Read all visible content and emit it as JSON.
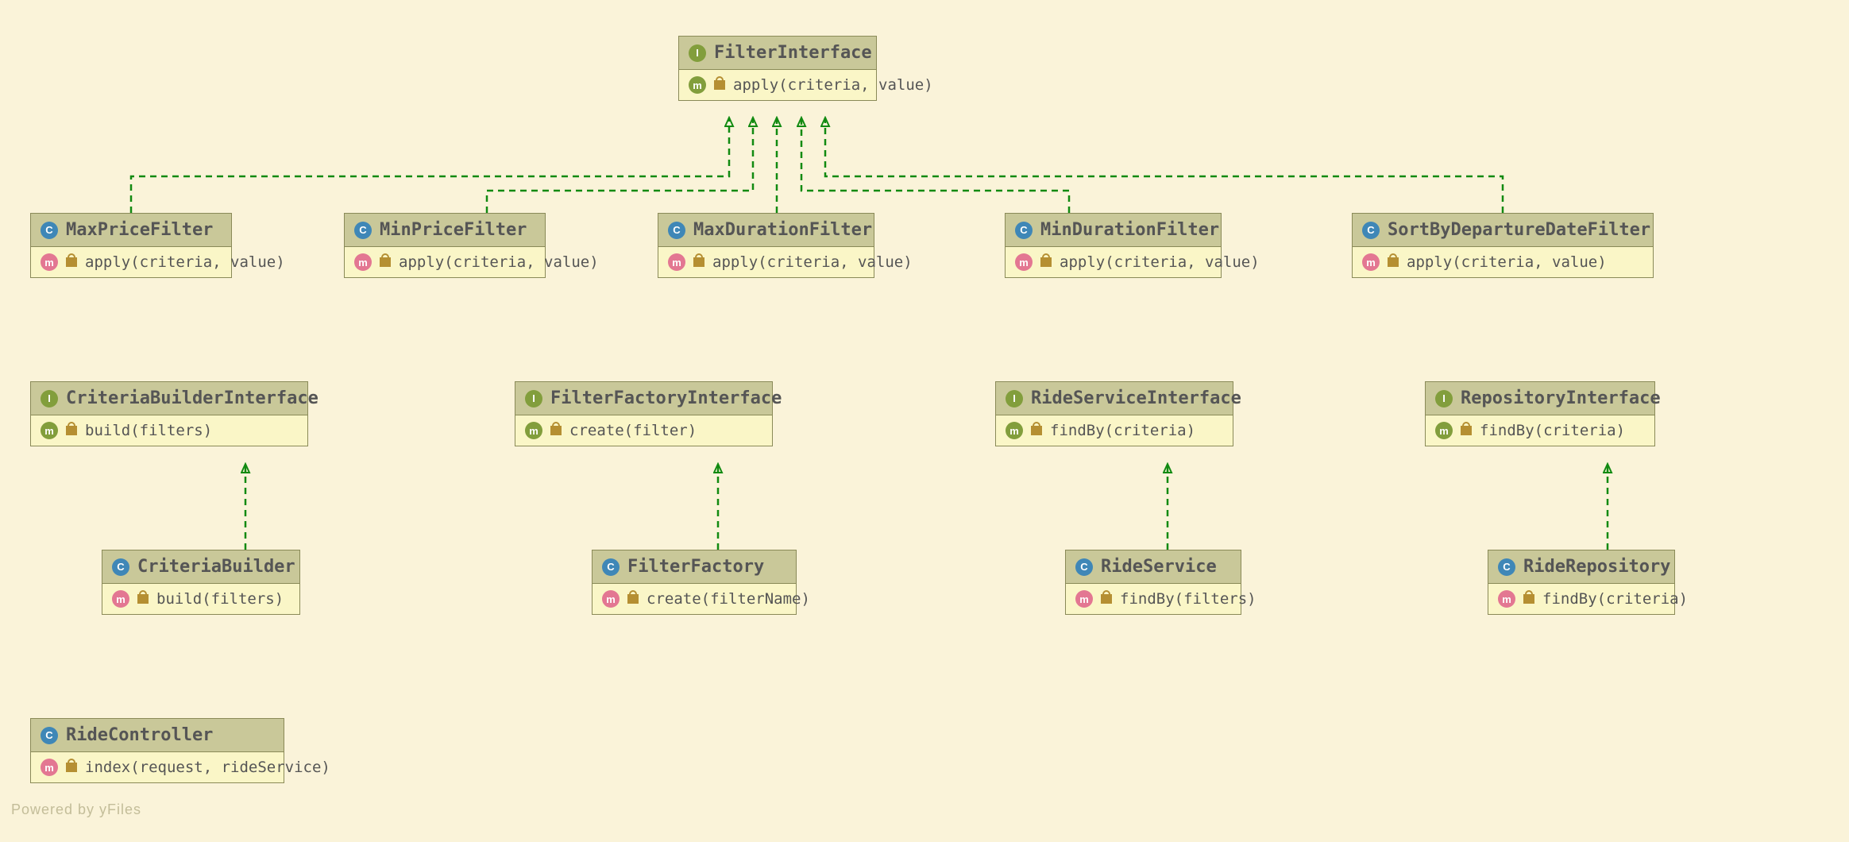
{
  "chart_data": {
    "type": "uml-class-diagram",
    "nodes": [
      {
        "id": "FilterInterface",
        "kind": "interface",
        "methods": [
          "apply(criteria, value)"
        ]
      },
      {
        "id": "MaxPriceFilter",
        "kind": "class",
        "methods": [
          "apply(criteria, value)"
        ]
      },
      {
        "id": "MinPriceFilter",
        "kind": "class",
        "methods": [
          "apply(criteria, value)"
        ]
      },
      {
        "id": "MaxDurationFilter",
        "kind": "class",
        "methods": [
          "apply(criteria, value)"
        ]
      },
      {
        "id": "MinDurationFilter",
        "kind": "class",
        "methods": [
          "apply(criteria, value)"
        ]
      },
      {
        "id": "SortByDepartureDateFilter",
        "kind": "class",
        "methods": [
          "apply(criteria, value)"
        ]
      },
      {
        "id": "CriteriaBuilderInterface",
        "kind": "interface",
        "methods": [
          "build(filters)"
        ]
      },
      {
        "id": "FilterFactoryInterface",
        "kind": "interface",
        "methods": [
          "create(filter)"
        ]
      },
      {
        "id": "RideServiceInterface",
        "kind": "interface",
        "methods": [
          "findBy(criteria)"
        ]
      },
      {
        "id": "RepositoryInterface",
        "kind": "interface",
        "methods": [
          "findBy(criteria)"
        ]
      },
      {
        "id": "CriteriaBuilder",
        "kind": "class",
        "methods": [
          "build(filters)"
        ]
      },
      {
        "id": "FilterFactory",
        "kind": "class",
        "methods": [
          "create(filterName)"
        ]
      },
      {
        "id": "RideService",
        "kind": "class",
        "methods": [
          "findBy(filters)"
        ]
      },
      {
        "id": "RideRepository",
        "kind": "class",
        "methods": [
          "findBy(criteria)"
        ]
      },
      {
        "id": "RideController",
        "kind": "class",
        "methods": [
          "index(request, rideService)"
        ]
      }
    ],
    "edges": [
      {
        "from": "MaxPriceFilter",
        "to": "FilterInterface",
        "type": "realization"
      },
      {
        "from": "MinPriceFilter",
        "to": "FilterInterface",
        "type": "realization"
      },
      {
        "from": "MaxDurationFilter",
        "to": "FilterInterface",
        "type": "realization"
      },
      {
        "from": "MinDurationFilter",
        "to": "FilterInterface",
        "type": "realization"
      },
      {
        "from": "SortByDepartureDateFilter",
        "to": "FilterInterface",
        "type": "realization"
      },
      {
        "from": "CriteriaBuilder",
        "to": "CriteriaBuilderInterface",
        "type": "realization"
      },
      {
        "from": "FilterFactory",
        "to": "FilterFactoryInterface",
        "type": "realization"
      },
      {
        "from": "RideService",
        "to": "RideServiceInterface",
        "type": "realization"
      },
      {
        "from": "RideRepository",
        "to": "RepositoryInterface",
        "type": "realization"
      }
    ]
  },
  "boxes": {
    "FilterInterface": {
      "kind": "I",
      "name": "FilterInterface",
      "method": "apply(criteria, value)"
    },
    "MaxPriceFilter": {
      "kind": "C",
      "name": "MaxPriceFilter",
      "method": "apply(criteria, value)"
    },
    "MinPriceFilter": {
      "kind": "C",
      "name": "MinPriceFilter",
      "method": "apply(criteria, value)"
    },
    "MaxDurationFilter": {
      "kind": "C",
      "name": "MaxDurationFilter",
      "method": "apply(criteria, value)"
    },
    "MinDurationFilter": {
      "kind": "C",
      "name": "MinDurationFilter",
      "method": "apply(criteria, value)"
    },
    "SortByDepartureDateFilter": {
      "kind": "C",
      "name": "SortByDepartureDateFilter",
      "method": "apply(criteria, value)"
    },
    "CriteriaBuilderInterface": {
      "kind": "I",
      "name": "CriteriaBuilderInterface",
      "method": "build(filters)"
    },
    "FilterFactoryInterface": {
      "kind": "I",
      "name": "FilterFactoryInterface",
      "method": "create(filter)"
    },
    "RideServiceInterface": {
      "kind": "I",
      "name": "RideServiceInterface",
      "method": "findBy(criteria)"
    },
    "RepositoryInterface": {
      "kind": "I",
      "name": "RepositoryInterface",
      "method": "findBy(criteria)"
    },
    "CriteriaBuilder": {
      "kind": "C",
      "name": "CriteriaBuilder",
      "method": "build(filters)"
    },
    "FilterFactory": {
      "kind": "C",
      "name": "FilterFactory",
      "method": "create(filterName)"
    },
    "RideService": {
      "kind": "C",
      "name": "RideService",
      "method": "findBy(filters)"
    },
    "RideRepository": {
      "kind": "C",
      "name": "RideRepository",
      "method": "findBy(criteria)"
    },
    "RideController": {
      "kind": "C",
      "name": "RideController",
      "method": "index(request, rideService)"
    }
  },
  "credit": "Powered by yFiles"
}
